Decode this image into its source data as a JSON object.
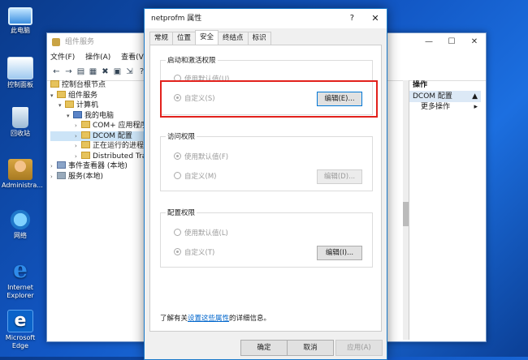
{
  "desktop": {
    "icons": [
      {
        "label": "此电脑"
      },
      {
        "label": "控制面板"
      },
      {
        "label": "回收站"
      },
      {
        "label": "Administra..."
      },
      {
        "label": "网络"
      },
      {
        "label": "Internet Explorer"
      },
      {
        "label": "Microsoft Edge"
      }
    ]
  },
  "bg_window": {
    "title": "组件服务",
    "menu": [
      "文件(F)",
      "操作(A)",
      "查看(V)"
    ],
    "tree": [
      {
        "label": "控制台根节点"
      },
      {
        "label": "组件服务"
      },
      {
        "label": "计算机"
      },
      {
        "label": "我的电脑"
      },
      {
        "label": "COM+ 应用程序"
      },
      {
        "label": "DCOM 配置"
      },
      {
        "label": "正在运行的进程"
      },
      {
        "label": "Distributed Tra"
      },
      {
        "label": "事件查看器 (本地)"
      },
      {
        "label": "服务(本地)"
      }
    ],
    "actions": {
      "header": "操作",
      "selected": "DCOM 配置",
      "more": "更多操作"
    }
  },
  "dialog": {
    "title": "netprofm 属性",
    "help": "?",
    "close": "✕",
    "tabs": [
      "常规",
      "位置",
      "安全",
      "终结点",
      "标识"
    ],
    "groups": {
      "launch": {
        "label": "启动和激活权限",
        "default": "使用默认值(U)",
        "custom": "自定义(S)",
        "edit": "编辑(E)..."
      },
      "access": {
        "label": "访问权限",
        "default": "使用默认值(F)",
        "custom": "自定义(M)",
        "edit": "编辑(D)..."
      },
      "config": {
        "label": "配置权限",
        "default": "使用默认值(L)",
        "custom": "自定义(T)",
        "edit": "编辑(I)..."
      }
    },
    "note_prefix": "了解有关",
    "note_link": "设置这些属性",
    "note_suffix": "的详细信息。",
    "buttons": {
      "ok": "确定",
      "cancel": "取消",
      "apply": "应用(A)"
    }
  }
}
